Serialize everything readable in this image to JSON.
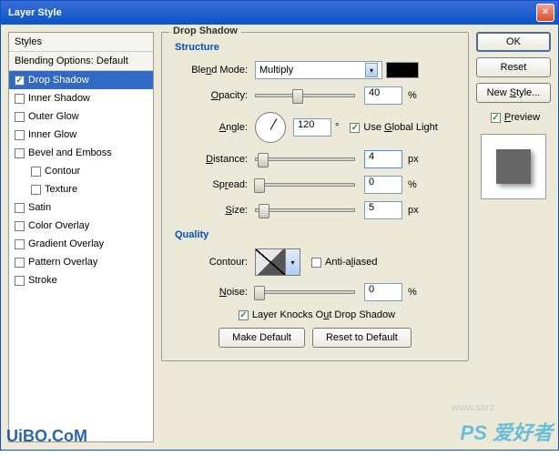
{
  "window": {
    "title": "Layer Style"
  },
  "sidebar": {
    "header": "Styles",
    "blending": "Blending Options: Default",
    "items": [
      {
        "label": "Drop Shadow",
        "checked": true,
        "selected": true
      },
      {
        "label": "Inner Shadow",
        "checked": false
      },
      {
        "label": "Outer Glow",
        "checked": false
      },
      {
        "label": "Inner Glow",
        "checked": false
      },
      {
        "label": "Bevel and Emboss",
        "checked": false
      },
      {
        "label": "Contour",
        "checked": false,
        "indent": true
      },
      {
        "label": "Texture",
        "checked": false,
        "indent": true
      },
      {
        "label": "Satin",
        "checked": false
      },
      {
        "label": "Color Overlay",
        "checked": false
      },
      {
        "label": "Gradient Overlay",
        "checked": false
      },
      {
        "label": "Pattern Overlay",
        "checked": false
      },
      {
        "label": "Stroke",
        "checked": false
      }
    ]
  },
  "main": {
    "title": "Drop Shadow",
    "structure": {
      "title": "Structure",
      "blend_mode_label": "Blend Mode:",
      "blend_mode_value": "Multiply",
      "color": "#000000",
      "opacity_label": "Opacity:",
      "opacity_value": "40",
      "opacity_unit": "%",
      "angle_label": "Angle:",
      "angle_value": "120",
      "angle_unit": "°",
      "global_light_checked": true,
      "global_light_label": "Use Global Light",
      "distance_label": "Distance:",
      "distance_value": "4",
      "distance_unit": "px",
      "spread_label": "Spread:",
      "spread_value": "0",
      "spread_unit": "%",
      "size_label": "Size:",
      "size_value": "5",
      "size_unit": "px"
    },
    "quality": {
      "title": "Quality",
      "contour_label": "Contour:",
      "anti_aliased_checked": false,
      "anti_aliased_label": "Anti-aliased",
      "noise_label": "Noise:",
      "noise_value": "0",
      "noise_unit": "%"
    },
    "knockout_checked": true,
    "knockout_label": "Layer Knocks Out Drop Shadow",
    "make_default": "Make Default",
    "reset_default": "Reset to Default"
  },
  "right": {
    "ok": "OK",
    "reset": "Reset",
    "new_style": "New Style...",
    "preview_checked": true,
    "preview_label": "Preview"
  },
  "watermark": {
    "left": "UiBO.CoM",
    "right": "PS 爱好者",
    "mid": "www.sarz"
  }
}
